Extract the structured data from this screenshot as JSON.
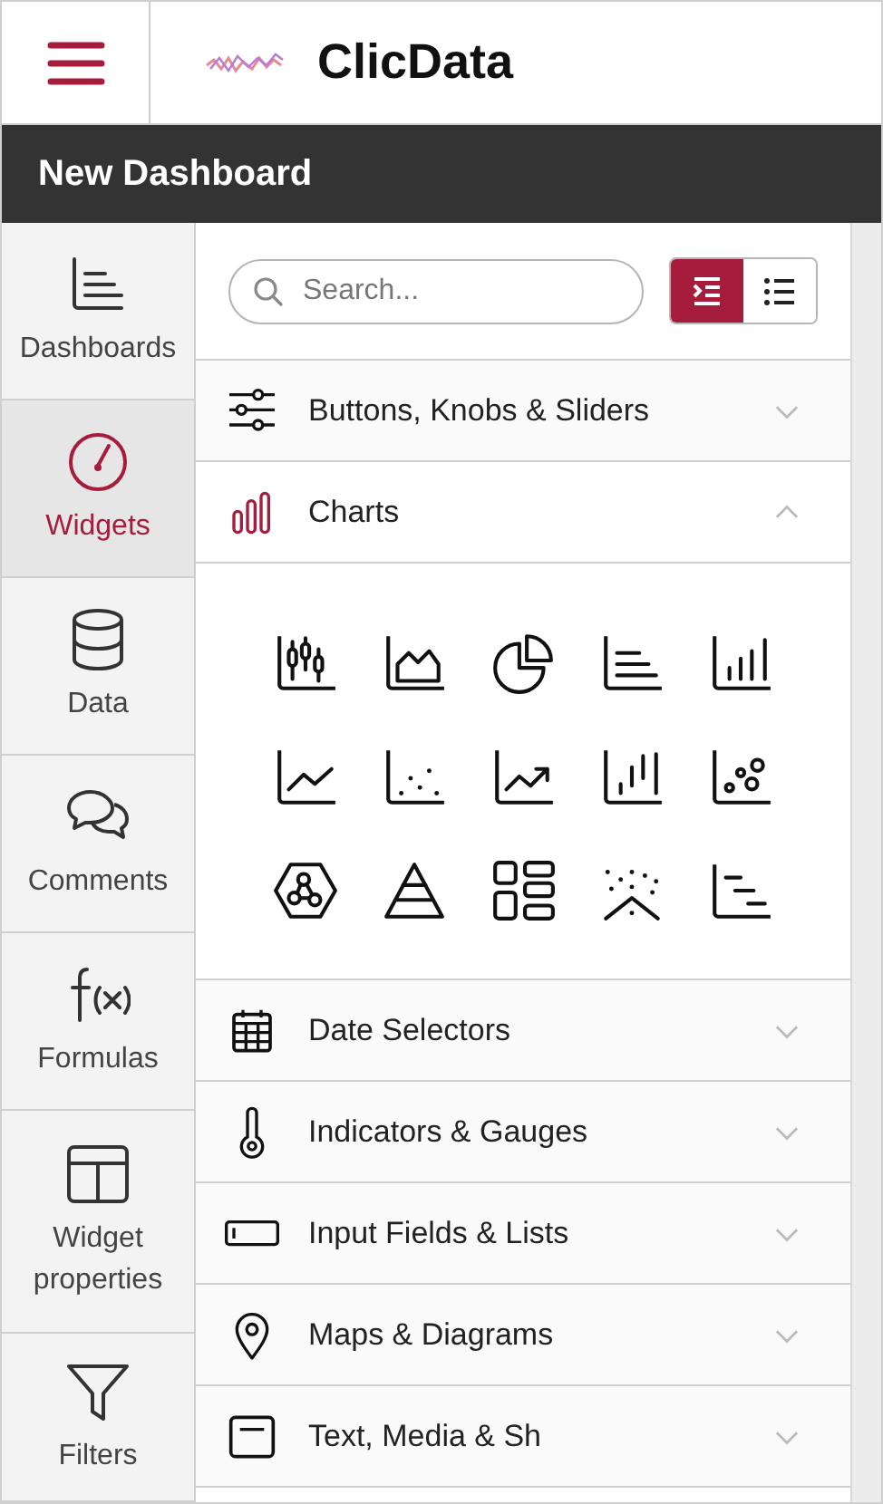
{
  "header": {
    "app_title": "ClicData"
  },
  "title_bar": {
    "title": "New Dashboard"
  },
  "sidebar": {
    "items": [
      {
        "label": "Dashboards",
        "selected": false
      },
      {
        "label": "Widgets",
        "selected": true
      },
      {
        "label": "Data",
        "selected": false
      },
      {
        "label": "Comments",
        "selected": false
      },
      {
        "label": "Formulas",
        "selected": false
      },
      {
        "label": "Widget properties",
        "selected": false
      },
      {
        "label": "Filters",
        "selected": false
      }
    ]
  },
  "search": {
    "placeholder": "Search..."
  },
  "view_toggle": [
    {
      "selected": true
    },
    {
      "selected": false
    }
  ],
  "categories": [
    {
      "label": "Buttons, Knobs & Sliders",
      "expanded": false
    },
    {
      "label": "Charts",
      "expanded": true
    },
    {
      "label": "Date Selectors",
      "expanded": false
    },
    {
      "label": "Indicators & Gauges",
      "expanded": false
    },
    {
      "label": "Input Fields & Lists",
      "expanded": false
    },
    {
      "label": "Maps & Diagrams",
      "expanded": false
    },
    {
      "label": "Text, Media & Sh",
      "expanded": false
    }
  ]
}
